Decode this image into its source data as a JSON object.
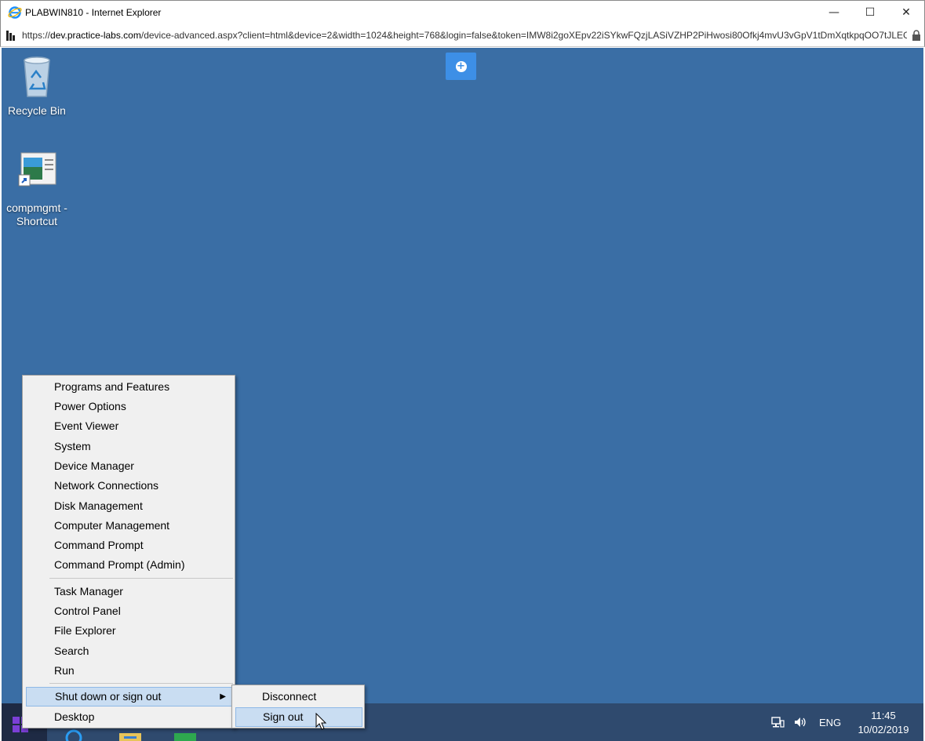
{
  "window": {
    "title": "PLABWIN810 - Internet Explorer",
    "minimize_glyph": "—",
    "maximize_glyph": "☐",
    "close_glyph": "✕"
  },
  "address": {
    "scheme": "https://",
    "host": "dev.practice-labs.com",
    "rest": "/device-advanced.aspx?client=html&device=2&width=1024&height=768&login=false&token=IMW8i2goXEpv22iSYkwFQzjLASiVZHP2PiHwosi80Ofkj4mvU3vGpV1tDmXqtkpqOO7tJLEG"
  },
  "desktop": {
    "icons": [
      {
        "label": "Recycle Bin",
        "icon": "recycle-bin-icon"
      },
      {
        "label": "compmgmt - Shortcut",
        "icon": "shortcut-icon"
      }
    ],
    "background_color": "#3a6ea5"
  },
  "context_menu": {
    "group1": [
      "Programs and Features",
      "Power Options",
      "Event Viewer",
      "System",
      "Device Manager",
      "Network Connections",
      "Disk Management",
      "Computer Management",
      "Command Prompt",
      "Command Prompt (Admin)"
    ],
    "group2": [
      "Task Manager",
      "Control Panel",
      "File Explorer",
      "Search",
      "Run"
    ],
    "shutdown": "Shut down or sign out",
    "shutdown_arrow": "▶",
    "desktop": "Desktop"
  },
  "submenu": {
    "items": [
      "Disconnect",
      "Sign out"
    ],
    "highlighted": "Sign out"
  },
  "taskbar": {
    "language": "ENG",
    "time": "11:45",
    "date": "10/02/2019"
  }
}
